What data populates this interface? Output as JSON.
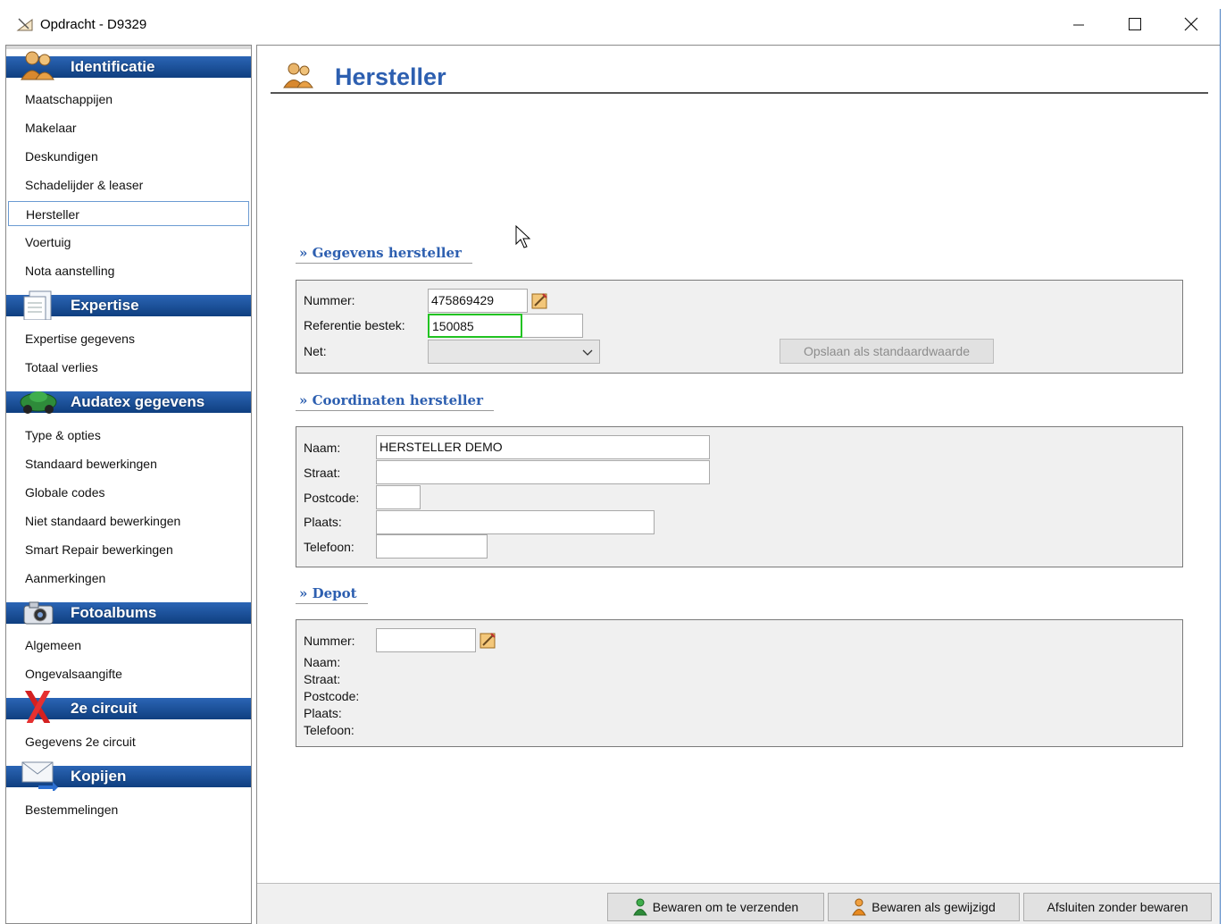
{
  "window": {
    "title": "Opdracht - D9329",
    "minimize": "minimize",
    "maximize": "maximize",
    "close": "close"
  },
  "sidebar": {
    "sections": [
      {
        "label": "Identificatie",
        "icon": "people-icon",
        "items": [
          "Maatschappijen",
          "Makelaar",
          "Deskundigen",
          "Schadelijder & leaser",
          "Hersteller",
          "Voertuig",
          "Nota aanstelling"
        ]
      },
      {
        "label": "Expertise",
        "icon": "document-icon",
        "items": [
          "Expertise gegevens",
          "Totaal verlies"
        ]
      },
      {
        "label": "Audatex gegevens",
        "icon": "car-icon",
        "items": [
          "Type & opties",
          "Standaard bewerkingen",
          "Globale codes",
          "Niet standaard bewerkingen",
          "Smart Repair bewerkingen",
          "Aanmerkingen"
        ]
      },
      {
        "label": "Fotoalbums",
        "icon": "camera-icon",
        "items": [
          "Algemeen",
          "Ongevalsaangifte"
        ]
      },
      {
        "label": "2e circuit",
        "icon": "red-x-icon",
        "items": [
          "Gegevens 2e circuit"
        ]
      },
      {
        "label": "Kopijen",
        "icon": "envelope-icon",
        "items": [
          "Bestemmelingen"
        ]
      }
    ],
    "selected": "Hersteller"
  },
  "main": {
    "title": "Hersteller",
    "gegevens": {
      "section_title": "» Gegevens hersteller",
      "nummer_label": "Nummer:",
      "nummer_value": "475869429",
      "referentie_label": "Referentie bestek:",
      "referentie_value": "150085",
      "net_label": "Net:",
      "net_value": "",
      "save_default_label": "Opslaan als standaardwaarde"
    },
    "coordinaten": {
      "section_title": "» Coordinaten hersteller",
      "naam_label": "Naam:",
      "naam_value": "HERSTELLER DEMO",
      "straat_label": "Straat:",
      "straat_value": "",
      "postcode_label": "Postcode:",
      "postcode_value": "",
      "plaats_label": "Plaats:",
      "plaats_value": "",
      "telefoon_label": "Telefoon:",
      "telefoon_value": ""
    },
    "depot": {
      "section_title": "» Depot",
      "nummer_label": "Nummer:",
      "nummer_value": "",
      "naam_label": "Naam:",
      "straat_label": "Straat:",
      "postcode_label": "Postcode:",
      "plaats_label": "Plaats:",
      "telefoon_label": "Telefoon:"
    }
  },
  "footer": {
    "send_label": "Bewaren om te verzenden",
    "modified_label": "Bewaren als gewijzigd",
    "close_label": "Afsluiten zonder bewaren"
  }
}
